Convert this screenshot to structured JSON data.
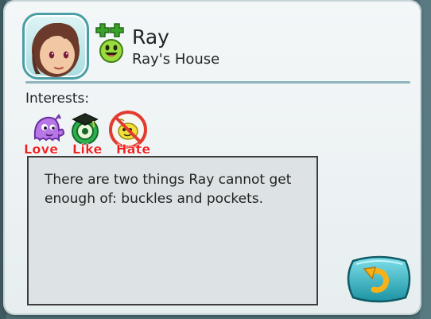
{
  "profile": {
    "name": "Ray",
    "house": "Ray's House",
    "portrait_icon": "mii-portrait",
    "personality_icon": "green-personality-face-icon"
  },
  "interests": {
    "label": "Interests:",
    "items": [
      {
        "kind": "love",
        "tag": "Love",
        "icon": "purple-ghost-icon"
      },
      {
        "kind": "like",
        "tag": "Like",
        "icon": "green-graduate-icon"
      },
      {
        "kind": "hate",
        "tag": "Hate",
        "icon": "yellow-blob-crossed-icon"
      }
    ]
  },
  "description": "There are two things Ray cannot get enough of: buckles and pockets.",
  "colors": {
    "tag_red": "#ee1c1c",
    "accent_teal": "#2fa9b7",
    "divider": "#8fb4bd"
  },
  "back_button": {
    "icon": "return-arrow-icon"
  }
}
